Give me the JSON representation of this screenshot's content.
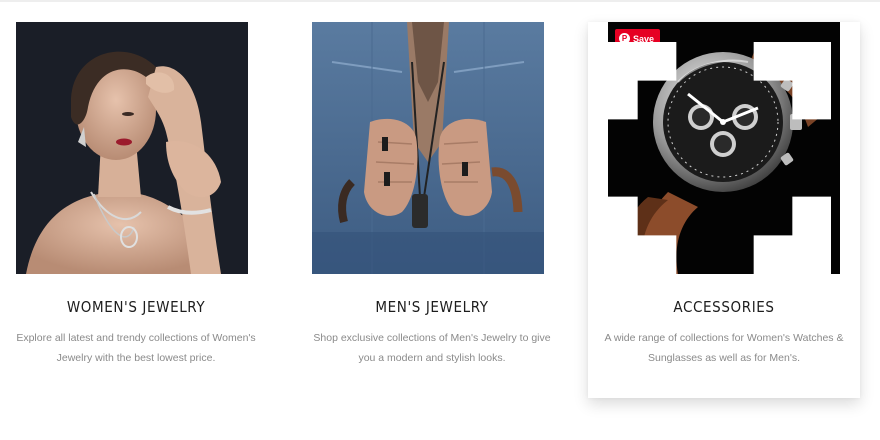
{
  "categories": [
    {
      "title": "WOMEN'S JEWELRY",
      "description": "Explore all latest and trendy collections of Women's Jewelry with the best lowest price.",
      "image_icon": "woman-jewelry-photo"
    },
    {
      "title": "MEN'S JEWELRY",
      "description": "Shop exclusive collections of Men's Jewelry to give you a modern and stylish looks.",
      "image_icon": "man-jewelry-photo"
    },
    {
      "title": "ACCESSORIES",
      "description": "A wide range of collections for Women's Watches & Sunglasses as well as for Men's.",
      "image_icon": "watch-photo"
    }
  ],
  "overlay": {
    "save_label": "Save",
    "save_color": "#e60023"
  }
}
